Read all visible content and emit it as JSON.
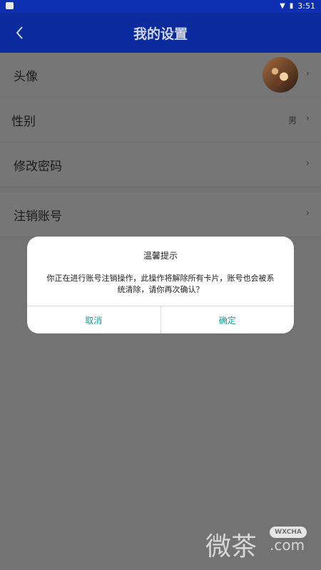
{
  "status_bar": {
    "time": "3:51",
    "icons": [
      "notification-icon",
      "wifi-icon",
      "battery-icon"
    ]
  },
  "app_bar": {
    "title": "我的设置",
    "back_icon": "chevron-left-icon"
  },
  "settings": {
    "items": [
      {
        "label": "头像",
        "value": ""
      },
      {
        "label": "性别",
        "value": "男"
      },
      {
        "label": "修改密码",
        "value": ""
      },
      {
        "label": "注销账号",
        "value": ""
      }
    ],
    "chevron": "›"
  },
  "dialog": {
    "title": "温馨提示",
    "message": "你正在进行账号注销操作，此操作将解除所有卡片，账号也会被系统清除，请你再次确认？",
    "cancel_label": "取消",
    "confirm_label": "确定"
  },
  "watermark": {
    "text": "微茶",
    "badge": "WXCHA",
    "domain": ".com"
  },
  "colors": {
    "appbar": "#0b2a9e",
    "accent": "#1aa39a",
    "overlay_bg": "#737373"
  }
}
